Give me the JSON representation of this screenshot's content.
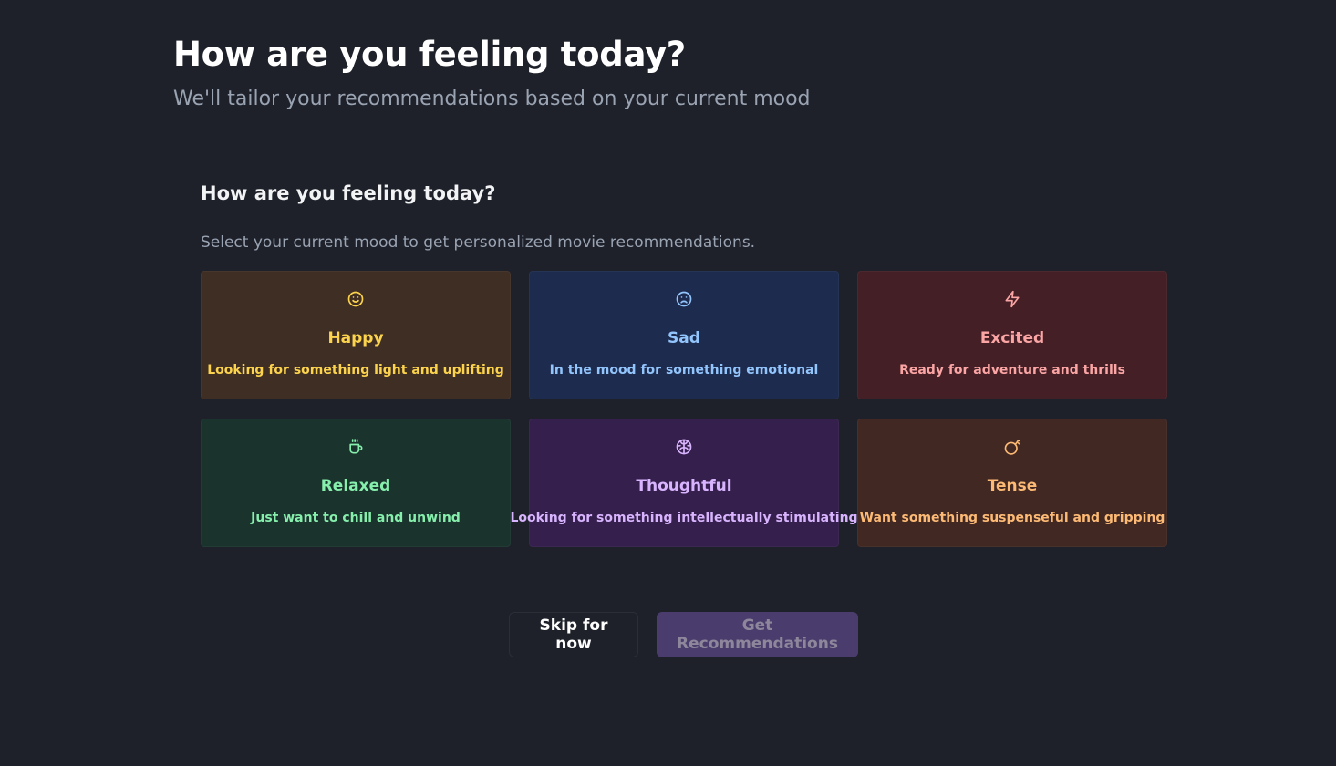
{
  "header": {
    "title": "How are you feeling today?",
    "subtitle": "We'll tailor your recommendations based on your current mood"
  },
  "section": {
    "title": "How are you feeling today?",
    "description": "Select your current mood to get personalized movie recommendations."
  },
  "moods": [
    {
      "name": "Happy",
      "description": "Looking for something light and uplifting",
      "icon": "smile-icon",
      "color": "#fcd34d",
      "background": "#3f2e23"
    },
    {
      "name": "Sad",
      "description": "In the mood for something emotional",
      "icon": "frown-icon",
      "color": "#93c5fd",
      "background": "#1d2b4e"
    },
    {
      "name": "Excited",
      "description": "Ready for adventure and thrills",
      "icon": "zap-icon",
      "color": "#fca5a5",
      "background": "#442026"
    },
    {
      "name": "Relaxed",
      "description": "Just want to chill and unwind",
      "icon": "coffee-icon",
      "color": "#86efac",
      "background": "#1a332d"
    },
    {
      "name": "Thoughtful",
      "description": "Looking for something intellectually stimulating",
      "icon": "brain-icon",
      "color": "#d8b4fe",
      "background": "#351f4d"
    },
    {
      "name": "Tense",
      "description": "Want something suspenseful and gripping",
      "icon": "bomb-icon",
      "color": "#fdba74",
      "background": "#412823"
    }
  ],
  "actions": {
    "skip_label": "Skip for now",
    "submit_label": "Get Recommendations"
  }
}
